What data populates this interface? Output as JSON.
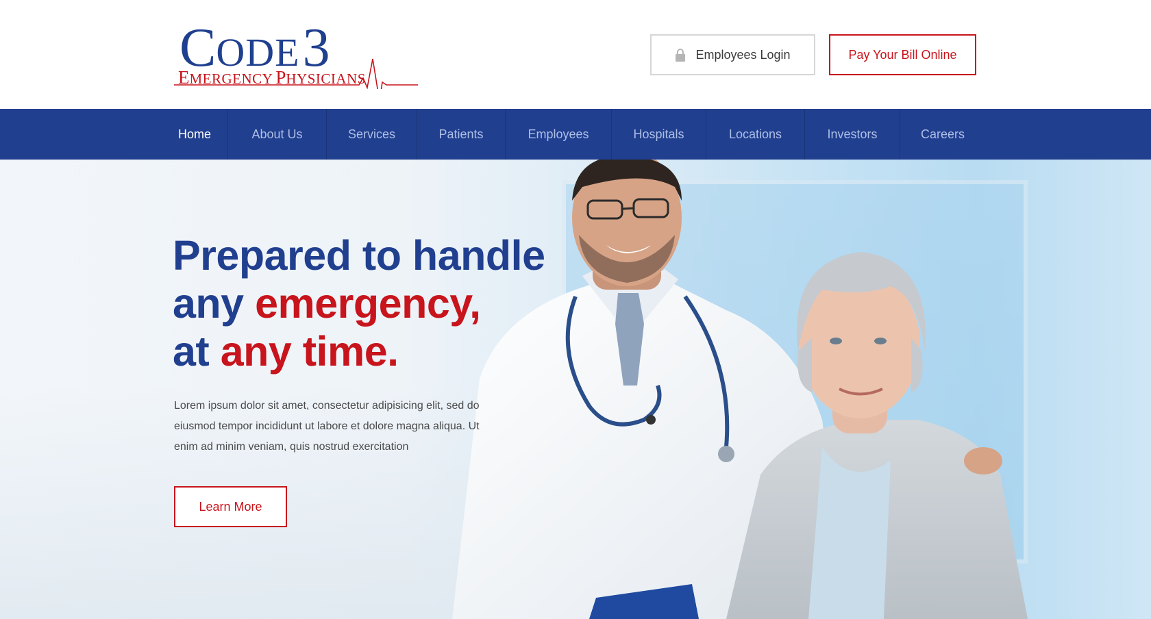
{
  "brand": {
    "logo_line1_first": "C",
    "logo_line1_rest": "ODE",
    "logo_line1_num": "3",
    "logo_line2_first_e": "E",
    "logo_line2_rest_e": "MERGENCY",
    "logo_line2_first_p": "P",
    "logo_line2_rest_p": "HYSICIANS"
  },
  "header": {
    "login_label": "Employees Login",
    "bill_label": "Pay Your Bill Online"
  },
  "nav": {
    "items": [
      {
        "label": "Home",
        "active": true
      },
      {
        "label": "About Us"
      },
      {
        "label": "Services"
      },
      {
        "label": "Patients"
      },
      {
        "label": "Employees"
      },
      {
        "label": "Hospitals"
      },
      {
        "label": "Locations"
      },
      {
        "label": "Investors"
      },
      {
        "label": "Careers"
      }
    ]
  },
  "hero": {
    "headline_line1": "Prepared to handle",
    "headline_line2_a": "any ",
    "headline_line2_b": "emergency,",
    "headline_line3_a": "at ",
    "headline_line3_b": "any time.",
    "lead": "Lorem ipsum dolor sit amet, consectetur adipisicing elit, sed do eiusmod tempor incididunt ut labore et dolore magna aliqua. Ut enim ad minim veniam, quis nostrud exercitation",
    "cta_label": "Learn More"
  },
  "icons": {
    "login": "lock-icon",
    "logo_graphic": "heartbeat-line"
  },
  "colors": {
    "brand_blue": "#213f8f",
    "brand_red": "#c8141c",
    "nav_text": "#aebfe6"
  }
}
